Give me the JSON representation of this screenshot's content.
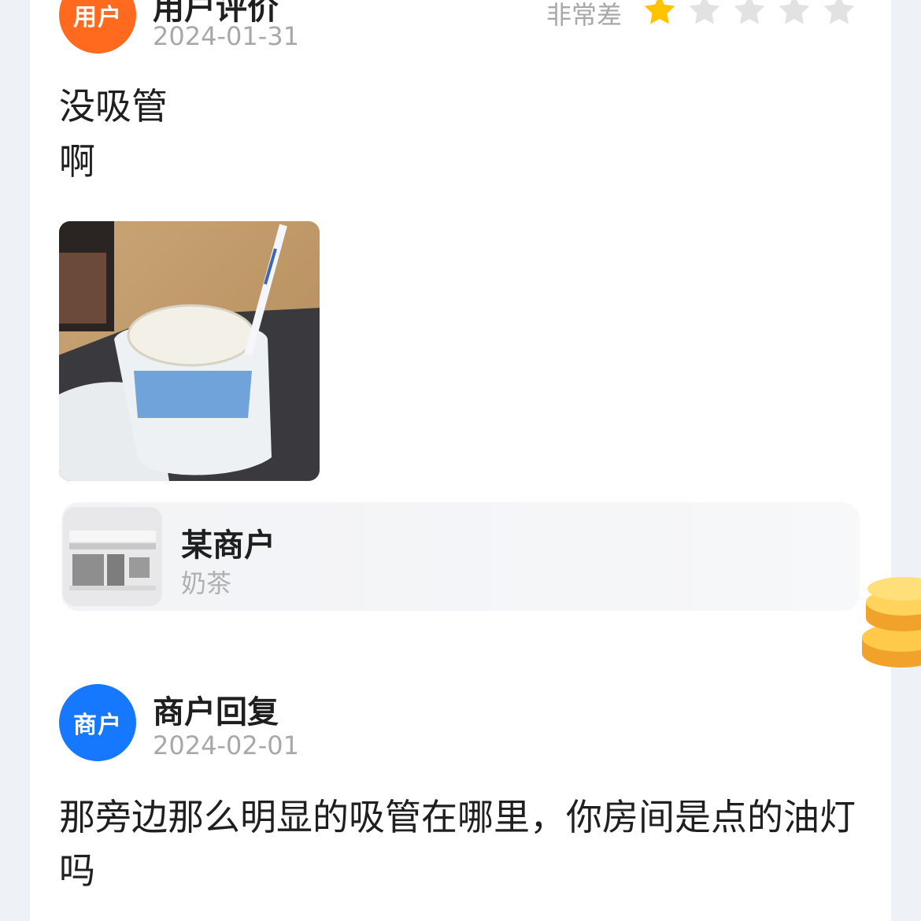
{
  "review": {
    "avatar_label": "用户",
    "author": "用户评价",
    "date": "2024-01-31",
    "rating_text": "非常差",
    "rating": 1,
    "rating_max": 5,
    "lines": [
      "没吸管",
      "啊"
    ]
  },
  "shop": {
    "name": "某商户",
    "category": "奶茶"
  },
  "reply": {
    "avatar_label": "商户",
    "author": "商户回复",
    "date": "2024-02-01",
    "text": "那旁边那么明显的吸管在哪里，你房间是点的油灯吗"
  },
  "colors": {
    "user_avatar": "#ff6a1f",
    "merchant_avatar": "#1677ff",
    "star_on": "#ffc300",
    "star_off": "#e2e2e2"
  },
  "icons": {
    "star": "star-icon",
    "coins": "coin-stack-icon",
    "shop": "storefront-icon"
  }
}
